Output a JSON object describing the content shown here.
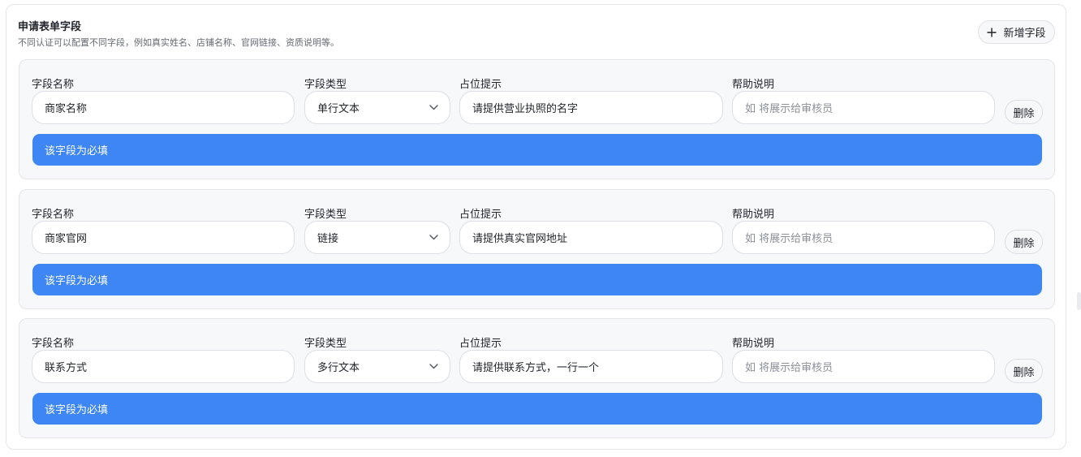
{
  "section": {
    "title": "申请表单字段",
    "subtitle": "不同认证可以配置不同字段，例如真实姓名、店铺名称、官网链接、资质说明等。",
    "add_button_label": "新增字段"
  },
  "labels": {
    "field_name": "字段名称",
    "field_type": "字段类型",
    "placeholder": "占位提示",
    "help_text": "帮助说明",
    "delete": "删除",
    "required": "该字段为必填"
  },
  "fields": [
    {
      "name": "商家名称",
      "type": "单行文本",
      "placeholder": "请提供营业执照的名字",
      "help_placeholder": "如 将展示给审核员"
    },
    {
      "name": "商家官网",
      "type": "链接",
      "placeholder": "请提供真实官网地址",
      "help_placeholder": "如 将展示给审核员"
    },
    {
      "name": "联系方式",
      "type": "多行文本",
      "placeholder": "请提供联系方式，一行一个",
      "help_placeholder": "如 将展示给审核员"
    }
  ],
  "colors": {
    "accent": "#3d86f4",
    "card_bg": "#f7f8fa",
    "border": "#e3e5e8"
  },
  "icons": {
    "add": "plus-icon",
    "select": "chevron-down-icon"
  }
}
